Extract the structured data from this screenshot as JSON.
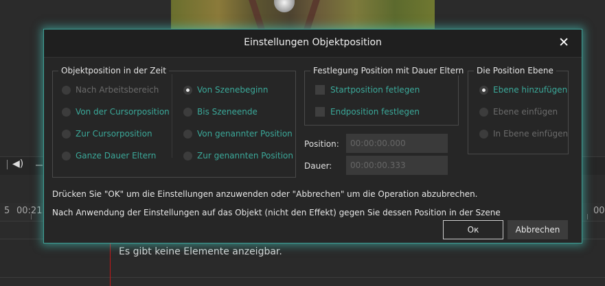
{
  "background": {
    "volume_icon": "speaker-icon",
    "timecodes": [
      "5",
      "00:21.",
      "00"
    ],
    "empty_message": "Es gibt keine Elemente anzeigbar."
  },
  "dialog": {
    "title": "Einstellungen Objektposition",
    "close_icon": "close-icon",
    "group_time": {
      "legend": "Objektposition in der Zeit",
      "options_left": [
        {
          "label": "Nach Arbeitsbereich",
          "checked": false,
          "enabled": false
        },
        {
          "label": "Von der Cursorposition",
          "checked": false,
          "enabled": true
        },
        {
          "label": "Zur Cursorposition",
          "checked": false,
          "enabled": true
        },
        {
          "label": "Ganze Dauer Eltern",
          "checked": false,
          "enabled": true
        }
      ],
      "options_right": [
        {
          "label": "Von Szenebeginn",
          "checked": true,
          "enabled": true
        },
        {
          "label": "Bis Szeneende",
          "checked": false,
          "enabled": true
        },
        {
          "label": "Von genannter Position",
          "checked": false,
          "enabled": true
        },
        {
          "label": "Zur genannten Position",
          "checked": false,
          "enabled": true
        }
      ]
    },
    "group_parent": {
      "legend": "Festlegung Position mit Dauer Eltern",
      "checkboxes": [
        {
          "label": "Startposition fetlegen",
          "checked": false
        },
        {
          "label": "Endposition festlegen",
          "checked": false
        }
      ]
    },
    "group_layer": {
      "legend": "Die Position Ebene",
      "options": [
        {
          "label": "Ebene hinzufügen",
          "checked": true,
          "enabled": true
        },
        {
          "label": "Ebene einfügen",
          "checked": false,
          "enabled": false
        },
        {
          "label": "In Ebene einfügen",
          "checked": false,
          "enabled": false
        }
      ]
    },
    "position": {
      "label": "Position:",
      "value": "00:00:00.000"
    },
    "duration": {
      "label": "Dauer:",
      "value": "00:00:00.333"
    },
    "message_1": "Drücken Sie \"OK\" um die Einstellungen anzuwenden oder \"Abbrechen\" um die Operation abzubrechen.",
    "message_2": "Nach Anwendung der Einstellungen auf das Objekt (nicht den Effekt) gegen Sie dessen Position in der Szene",
    "ok_label": "Ок",
    "cancel_label": "Abbrechen",
    "colors": {
      "accent": "#3ba99a",
      "border_glow": "#46c8be",
      "disabled": "#6b6b6b"
    }
  }
}
